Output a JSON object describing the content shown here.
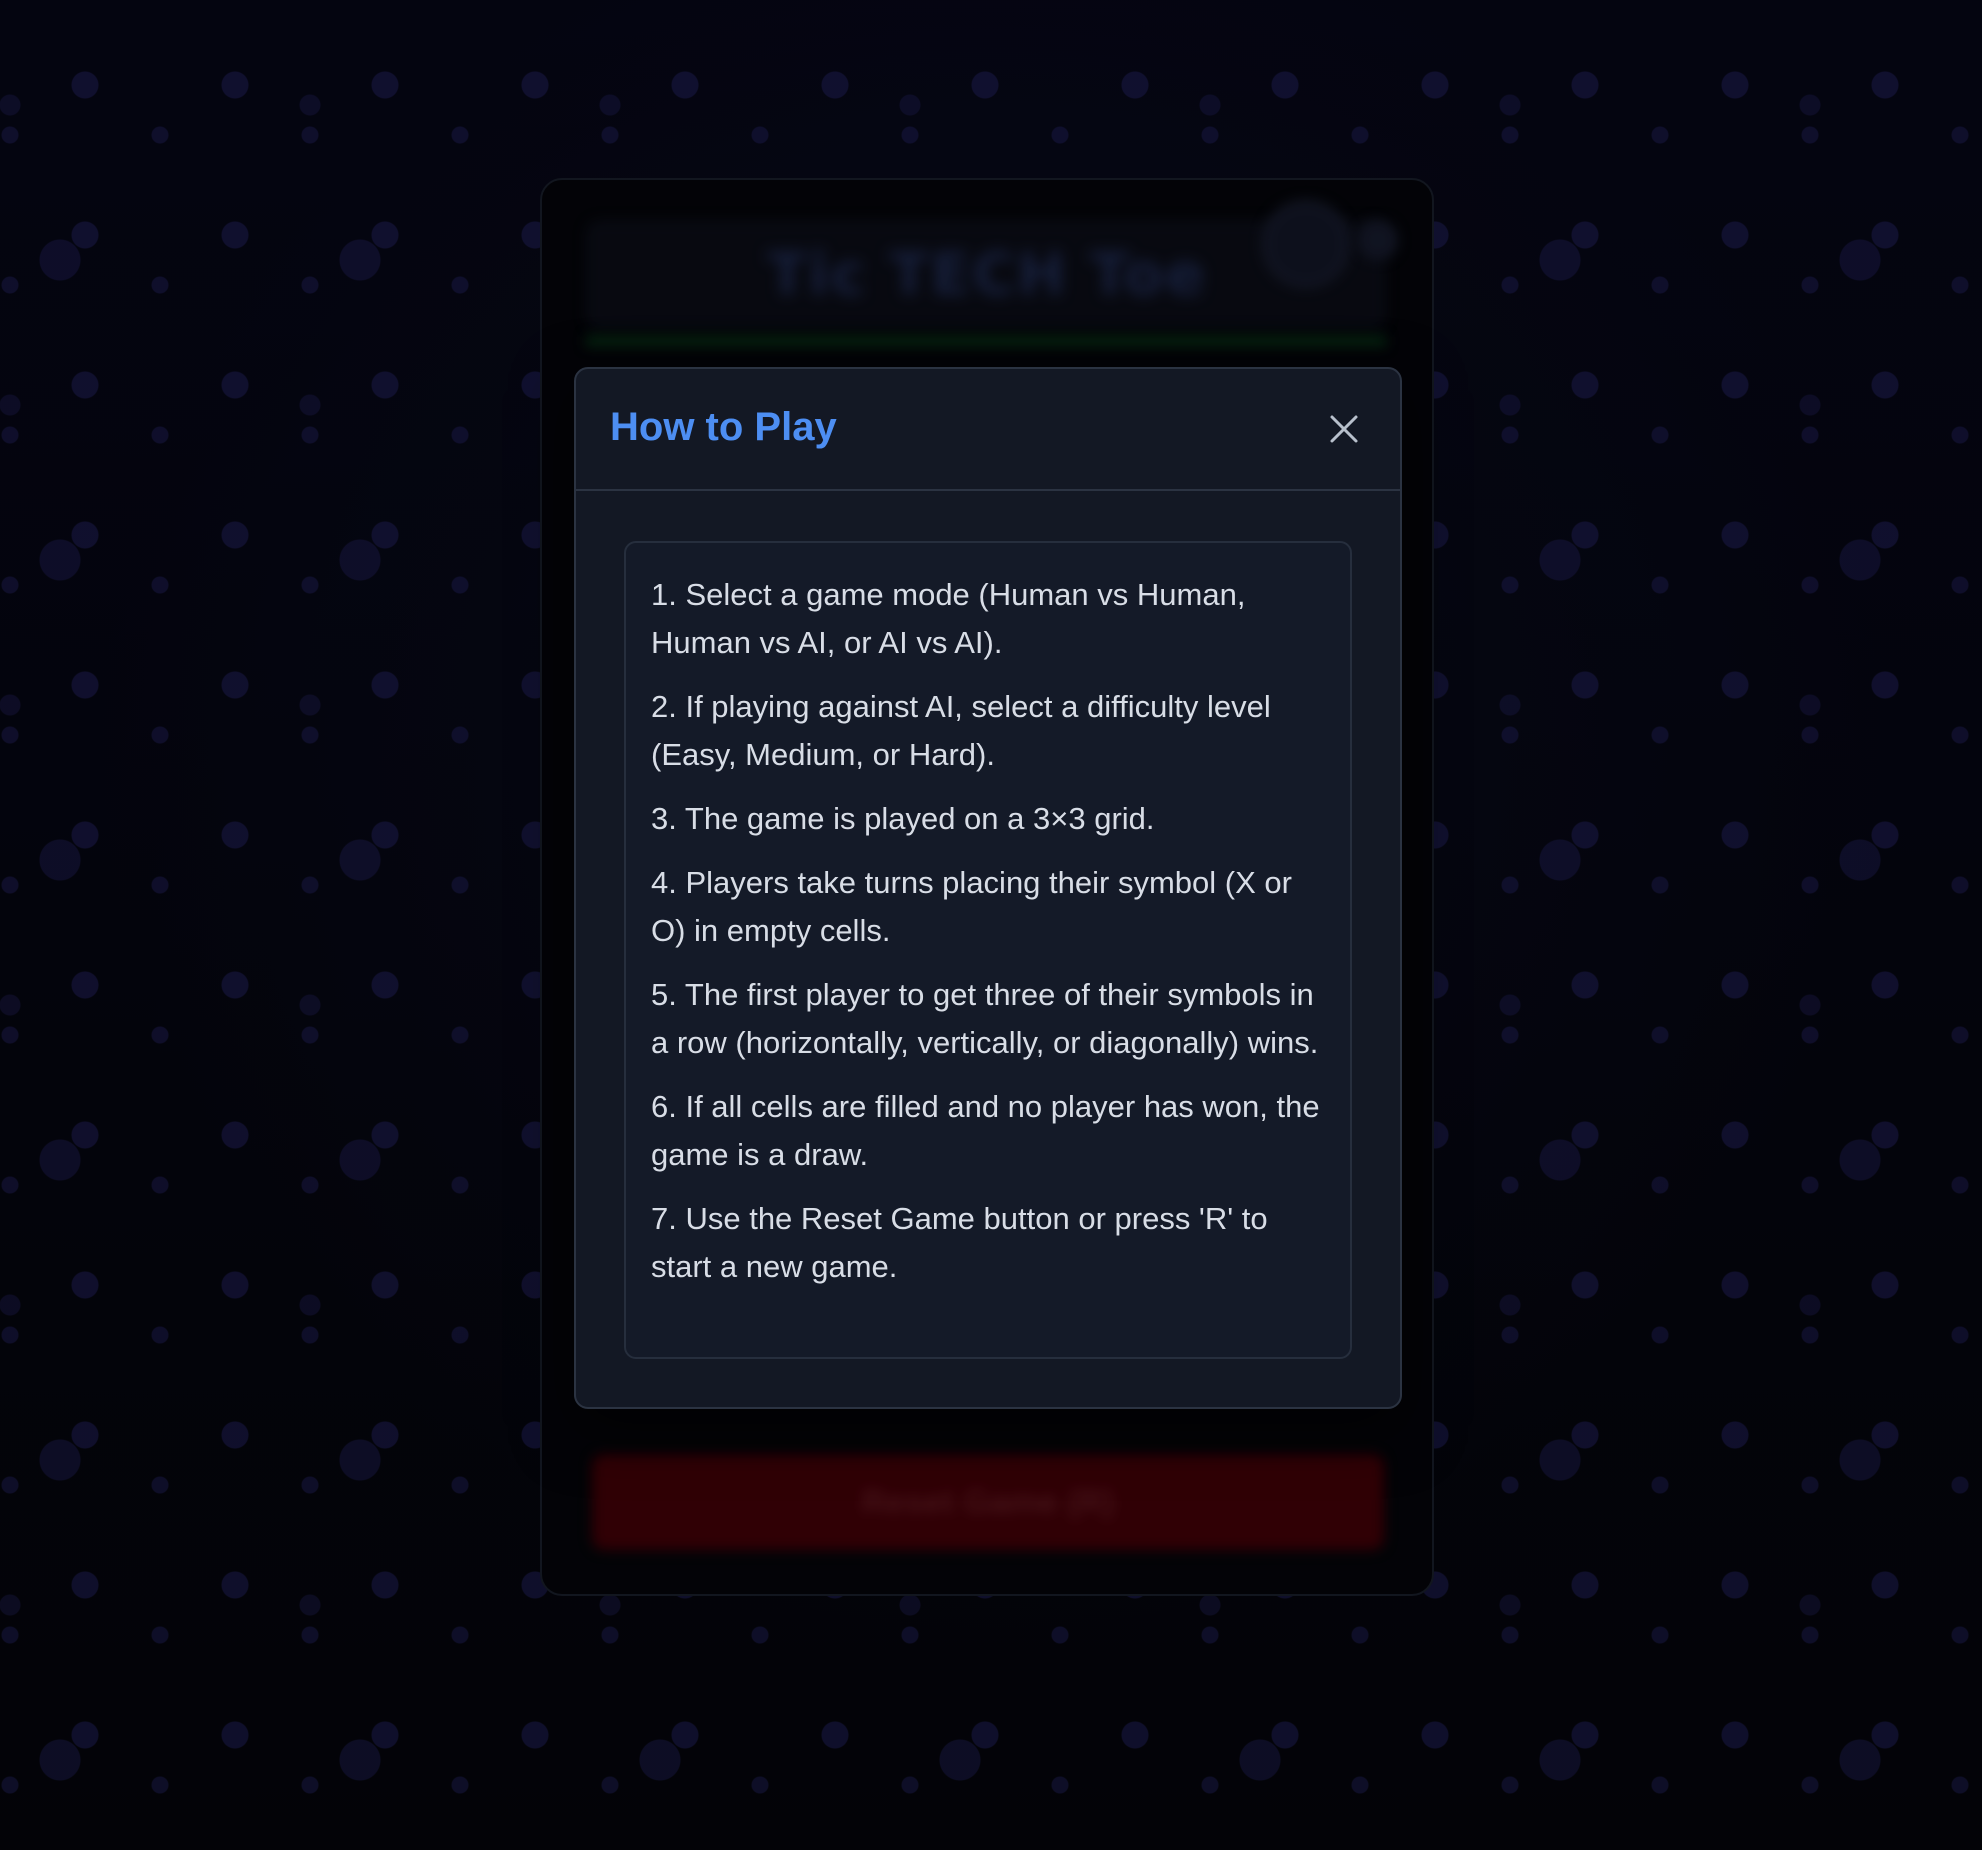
{
  "app": {
    "title": "Tic TECH Toe",
    "reset_button_label": "Reset Game (R)"
  },
  "modal": {
    "title": "How to Play",
    "close_icon": "close-icon",
    "instructions": [
      "1. Select a game mode (Human vs Human, Human vs AI, or AI vs AI).",
      "2. If playing against AI, select a difficulty level (Easy, Medium, or Hard).",
      "3. The game is played on a 3×3 grid.",
      "4. Players take turns placing their symbol (X or O) in empty cells.",
      "5. The first player to get three of their symbols in a row (horizontally, vertically, or diagonally) wins.",
      "6. If all cells are filled and no player has won, the game is a draw.",
      "7. Use the Reset Game button or press 'R' to start a new game."
    ]
  },
  "colors": {
    "accent": "#4d8ef2",
    "modal_bg": "#131824",
    "text": "#d8dde6"
  }
}
